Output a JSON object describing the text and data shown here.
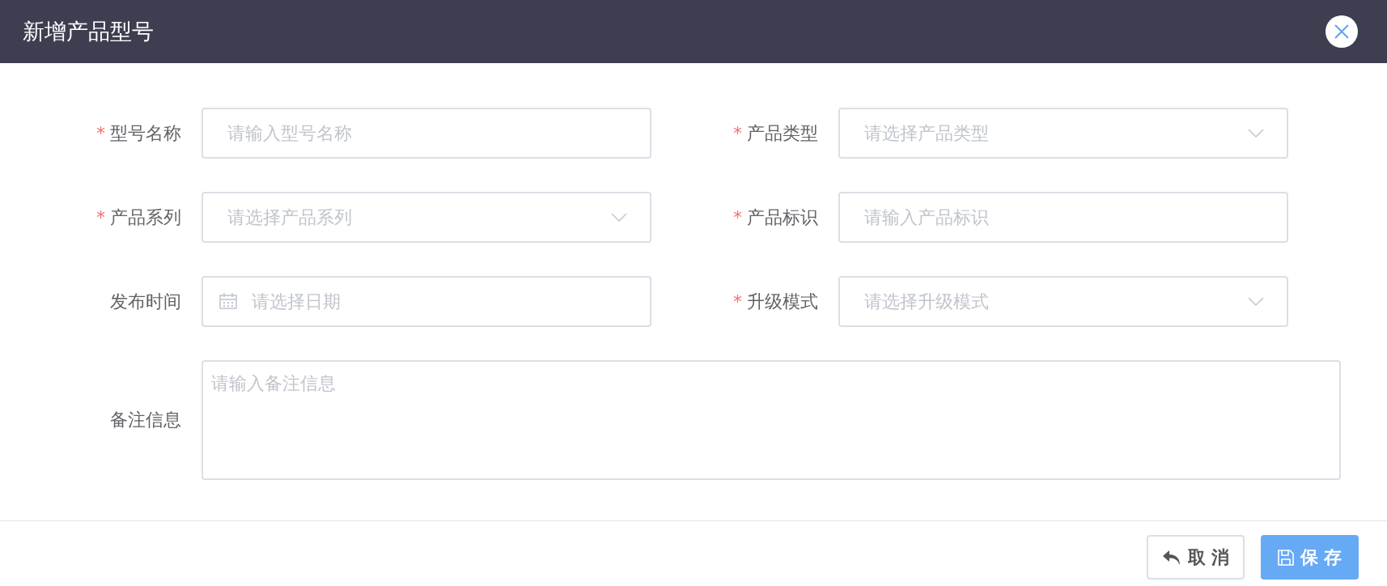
{
  "dialog": {
    "title": "新增产品型号"
  },
  "fields": [
    {
      "kind": "text",
      "label": "型号名称",
      "required_mark": "*",
      "placeholder": "请输入型号名称"
    },
    {
      "kind": "select",
      "label": "产品类型",
      "required_mark": "*",
      "placeholder": "请选择产品类型"
    },
    {
      "kind": "select",
      "label": "产品系列",
      "required_mark": "*",
      "placeholder": "请选择产品系列"
    },
    {
      "kind": "text",
      "label": "产品标识",
      "required_mark": "*",
      "placeholder": "请输入产品标识"
    },
    {
      "kind": "date",
      "label": "发布时间",
      "placeholder": "请选择日期"
    },
    {
      "kind": "select",
      "label": "升级模式",
      "required_mark": "*",
      "placeholder": "请选择升级模式"
    },
    {
      "kind": "textarea",
      "label": "备注信息",
      "placeholder": "请输入备注信息"
    }
  ],
  "buttons": [
    {
      "kind": "cancel",
      "label": "取 消"
    },
    {
      "kind": "save",
      "label": "保 存"
    }
  ]
}
